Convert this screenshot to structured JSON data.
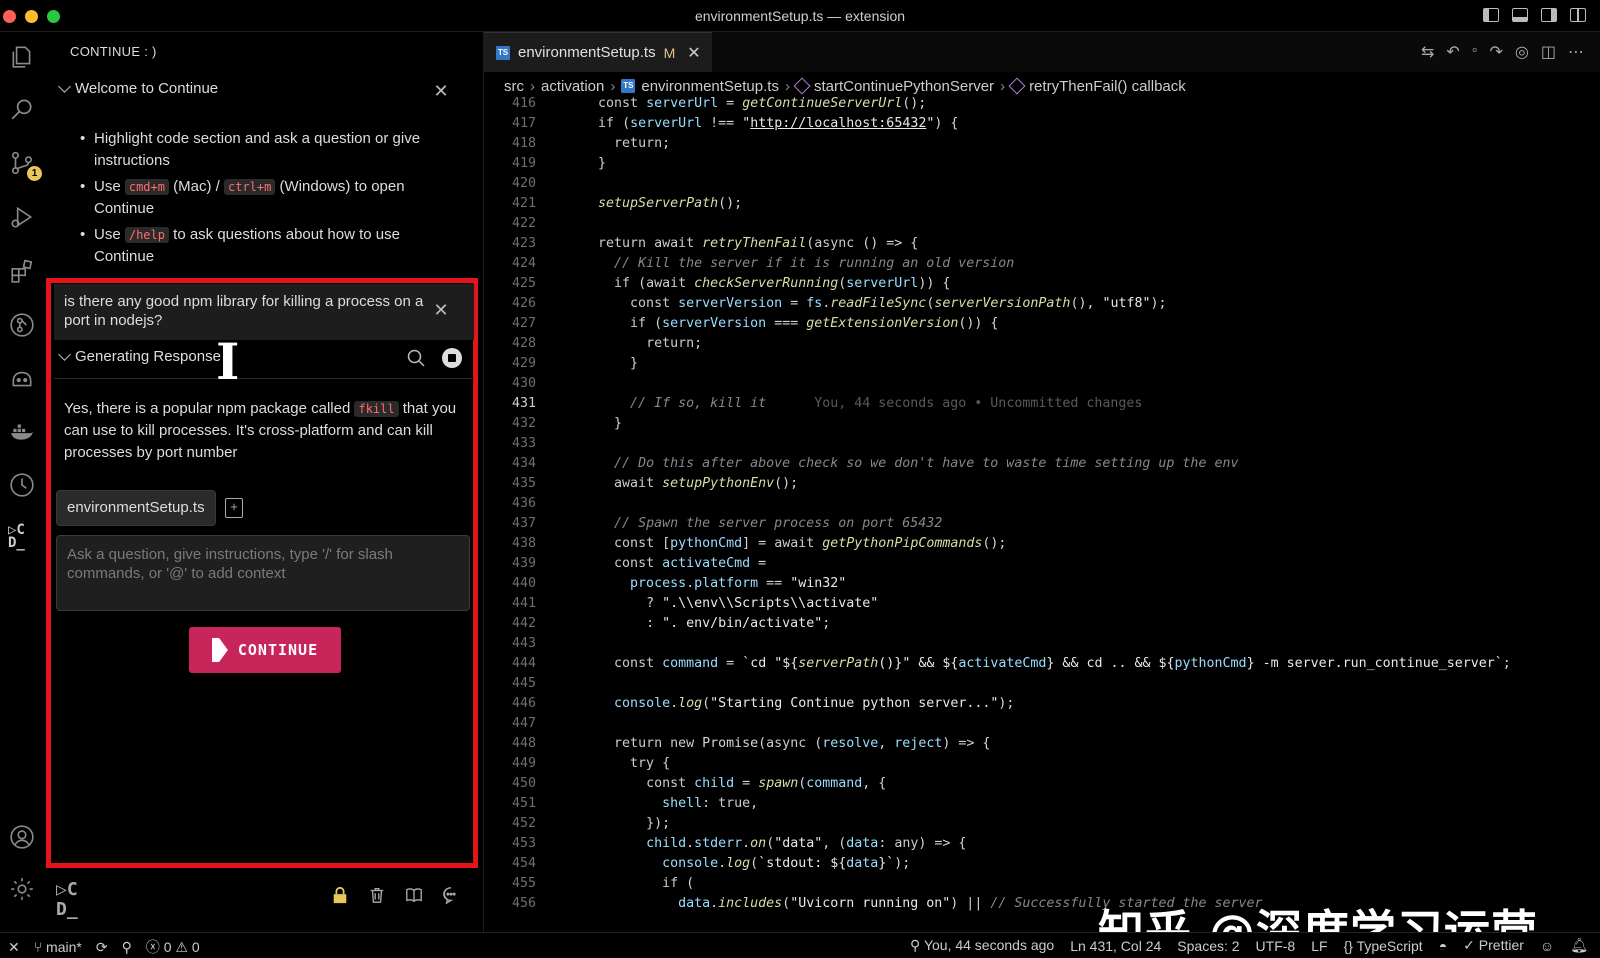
{
  "window": {
    "title": "environmentSetup.ts — extension"
  },
  "activity_bar": {
    "scm_badge": "1",
    "continue_glyph": "▷C\nD_"
  },
  "side_panel": {
    "title": "CONTINUE : )",
    "welcome": {
      "heading": "Welcome to Continue",
      "bullet1": "Highlight code section and ask a question or give instructions",
      "bullet2_pre": "Use",
      "bullet2_kbd1": "cmd+m",
      "bullet2_mid1": "(Mac) /",
      "bullet2_kbd2": "ctrl+m",
      "bullet2_post": "(Windows) to open Continue",
      "bullet3_pre": "Use",
      "bullet3_kbd": "/help",
      "bullet3_post": "to ask questions about how to use Continue"
    },
    "query": "is there any good npm library for killing a process on a port in nodejs?",
    "generating_heading": "Generating Response",
    "response_pre": "Yes, there is a popular npm package called",
    "response_kbd": "fkill",
    "response_post": "that you can use to kill processes. It's cross-platform and can kill processes by port number",
    "context_chip": "environmentSetup.ts",
    "input_placeholder": "Ask a question, give instructions, type '/' for slash commands, or '@' to add context",
    "continue_button": "CONTINUE",
    "bottom_glyph": "▷C\nD_"
  },
  "editor": {
    "tab": {
      "filename": "environmentSetup.ts",
      "badge": "TS",
      "modified": "M"
    },
    "breadcrumb": {
      "seg1": "src",
      "seg2": "activation",
      "seg3": "environmentSetup.ts",
      "seg4": "startContinuePythonServer",
      "seg5": "retryThenFail() callback"
    },
    "lines": [
      {
        "n": "416",
        "html": "    <span class='kw'>const</span> <span class='var'>serverUrl</span> <span class='plain'>=</span> <span class='fn'>getContinueServerUrl</span><span class='plain'>();</span>"
      },
      {
        "n": "417",
        "html": "    <span class='kw'>if</span> <span class='plain'>(</span><span class='var'>serverUrl</span> <span class='plain'>!==</span> <span class='str'>\"<u>http://localhost:65432</u>\"</span><span class='plain'>) {</span>"
      },
      {
        "n": "418",
        "html": "      <span class='kw'>return</span><span class='plain'>;</span>"
      },
      {
        "n": "419",
        "html": "    <span class='plain'>}</span>"
      },
      {
        "n": "420",
        "html": ""
      },
      {
        "n": "421",
        "html": "    <span class='fn'>setupServerPath</span><span class='plain'>();</span>"
      },
      {
        "n": "422",
        "html": ""
      },
      {
        "n": "423",
        "html": "    <span class='kw'>return await</span> <span class='fn'>retryThenFail</span><span class='plain'>(</span><span class='kw'>async</span> <span class='plain'>() =&gt; {</span>"
      },
      {
        "n": "424",
        "html": "      <span class='cm'>// Kill the server if it is running an old version</span>"
      },
      {
        "n": "425",
        "html": "      <span class='kw'>if</span> <span class='plain'>(</span><span class='kw'>await</span> <span class='fn'>checkServerRunning</span><span class='plain'>(</span><span class='var'>serverUrl</span><span class='plain'>)) {</span>"
      },
      {
        "n": "426",
        "html": "        <span class='kw'>const</span> <span class='var'>serverVersion</span> <span class='plain'>=</span> <span class='var'>fs</span><span class='plain'>.</span><span class='fn'>readFileSync</span><span class='plain'>(</span><span class='fn'>serverVersionPath</span><span class='plain'>(), </span><span class='str'>\"utf8\"</span><span class='plain'>);</span>"
      },
      {
        "n": "427",
        "html": "        <span class='kw'>if</span> <span class='plain'>(</span><span class='var'>serverVersion</span> <span class='plain'>===</span> <span class='fn'>getExtensionVersion</span><span class='plain'>()) {</span>"
      },
      {
        "n": "428",
        "html": "          <span class='kw'>return</span><span class='plain'>;</span>"
      },
      {
        "n": "429",
        "html": "        <span class='plain'>}</span>"
      },
      {
        "n": "430",
        "html": ""
      },
      {
        "n": "431",
        "html": "        <span class='cm'>// If so, kill it</span>      <span class='blame'>You, 44 seconds ago • Uncommitted changes</span>",
        "active": true
      },
      {
        "n": "432",
        "html": "      <span class='plain'>}</span>"
      },
      {
        "n": "433",
        "html": ""
      },
      {
        "n": "434",
        "html": "      <span class='cm'>// Do this after above check so we don't have to waste time setting up the env</span>"
      },
      {
        "n": "435",
        "html": "      <span class='kw'>await</span> <span class='fn'>setupPythonEnv</span><span class='plain'>();</span>"
      },
      {
        "n": "436",
        "html": ""
      },
      {
        "n": "437",
        "html": "      <span class='cm'>// Spawn the server process on port 65432</span>"
      },
      {
        "n": "438",
        "html": "      <span class='kw'>const</span> <span class='plain'>[</span><span class='var'>pythonCmd</span><span class='plain'>] =</span> <span class='kw'>await</span> <span class='fn'>getPythonPipCommands</span><span class='plain'>();</span>"
      },
      {
        "n": "439",
        "html": "      <span class='kw'>const</span> <span class='var'>activateCmd</span> <span class='plain'>=</span>"
      },
      {
        "n": "440",
        "html": "        <span class='var'>process</span><span class='plain'>.</span><span class='var'>platform</span> <span class='plain'>==</span> <span class='str'>\"win32\"</span>"
      },
      {
        "n": "441",
        "html": "          <span class='plain'>?</span> <span class='str'>\".\\\\env\\\\Scripts\\\\activate\"</span>"
      },
      {
        "n": "442",
        "html": "          <span class='plain'>:</span> <span class='str'>\". env/bin/activate\"</span><span class='plain'>;</span>"
      },
      {
        "n": "443",
        "html": ""
      },
      {
        "n": "444",
        "html": "      <span class='kw'>const</span> <span class='var'>command</span> <span class='plain'>=</span> <span class='str'>`cd \"${</span><span class='fn'>serverPath</span><span class='str'>()}\" &amp;&amp; ${</span><span class='var'>activateCmd</span><span class='str'>} &amp;&amp; cd .. &amp;&amp; ${</span><span class='var'>pythonCmd</span><span class='str'>} -m server.run_continue_server`</span><span class='plain'>;</span>"
      },
      {
        "n": "445",
        "html": ""
      },
      {
        "n": "446",
        "html": "      <span class='var'>console</span><span class='plain'>.</span><span class='fn'>log</span><span class='plain'>(</span><span class='str'>\"Starting Continue python server...\"</span><span class='plain'>);</span>"
      },
      {
        "n": "447",
        "html": ""
      },
      {
        "n": "448",
        "html": "      <span class='kw'>return new</span> <span class='plain'>Promise(</span><span class='kw'>async</span> <span class='plain'>(</span><span class='var'>resolve</span><span class='plain'>, </span><span class='var'>reject</span><span class='plain'>) =&gt; {</span>"
      },
      {
        "n": "449",
        "html": "        <span class='kw'>try</span> <span class='plain'>{</span>"
      },
      {
        "n": "450",
        "html": "          <span class='kw'>const</span> <span class='var'>child</span> <span class='plain'>=</span> <span class='fn'>spawn</span><span class='plain'>(</span><span class='var'>command</span><span class='plain'>, {</span>"
      },
      {
        "n": "451",
        "html": "            <span class='var'>shell</span><span class='plain'>: </span><span class='kw'>true</span><span class='plain'>,</span>"
      },
      {
        "n": "452",
        "html": "          <span class='plain'>});</span>"
      },
      {
        "n": "453",
        "html": "          <span class='var'>child</span><span class='plain'>.</span><span class='var'>stderr</span><span class='plain'>.</span><span class='fn'>on</span><span class='plain'>(</span><span class='str'>\"data\"</span><span class='plain'>, (</span><span class='var'>data</span><span class='plain'>: </span><span class='kw'>any</span><span class='plain'>) =&gt; {</span>"
      },
      {
        "n": "454",
        "html": "            <span class='var'>console</span><span class='plain'>.</span><span class='fn'>log</span><span class='plain'>(</span><span class='str'>`stdout: ${</span><span class='var'>data</span><span class='str'>}`</span><span class='plain'>);</span>"
      },
      {
        "n": "455",
        "html": "            <span class='kw'>if</span> <span class='plain'>(</span>"
      },
      {
        "n": "456",
        "html": "              <span class='var'>data</span><span class='plain'>.</span><span class='fn'>includes</span><span class='plain'>(</span><span class='str'>\"Uvicorn running on\"</span><span class='plain'>) ||</span> <span class='cm'>// Successfully started the server</span>"
      }
    ]
  },
  "watermark": "知乎 @深度学习运营",
  "status_bar": {
    "branch": "main*",
    "errors": "0",
    "warnings": "0",
    "blame": "You, 44 seconds ago",
    "position": "Ln 431, Col 24",
    "spaces": "Spaces: 2",
    "encoding": "UTF-8",
    "eol": "LF",
    "language": "TypeScript",
    "formatter": "✓ Prettier"
  }
}
